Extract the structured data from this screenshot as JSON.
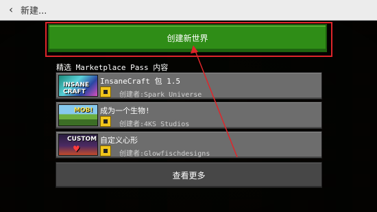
{
  "window": {
    "title": "新建..."
  },
  "create_button": {
    "label": "创建新世界"
  },
  "marketplace": {
    "section_label": "精选 Marketplace Pass 内容",
    "items": [
      {
        "name": "InsaneCraft 包 1.5",
        "creator": "创建者:Spark Universe",
        "thumb_text": "INSANE CRAFT"
      },
      {
        "name": "成为一个生物!",
        "creator": "创建者:4KS Studios",
        "thumb_text": "MOB!"
      },
      {
        "name": "自定义心形",
        "creator": "创建者:Glowfischdesigns",
        "thumb_text": "CUSTOM"
      }
    ],
    "see_more_label": "查看更多"
  },
  "colors": {
    "create_button": "#2f8d17",
    "annotation": "#e0252a",
    "item_background": "#6d6d6d",
    "badge": "#f0c51c"
  },
  "icons": {
    "back": "chevron-left-icon",
    "badge": "marketplace-pass-icon"
  }
}
